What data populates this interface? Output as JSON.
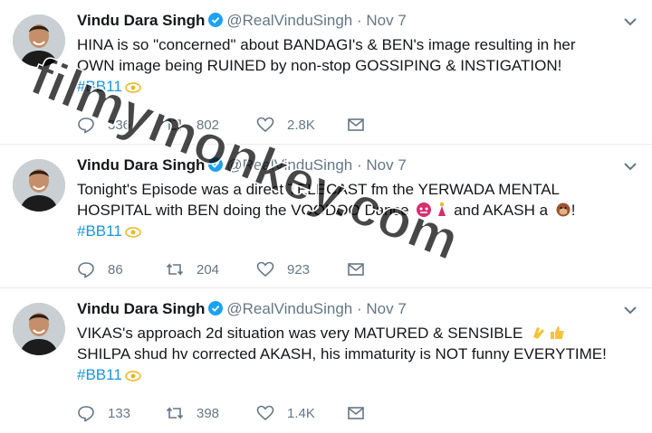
{
  "tweets": [
    {
      "name": "Vindu Dara Singh",
      "handle": "@RealVinduSingh",
      "separator": "·",
      "date": "Nov 7",
      "line1": "HINA is so \"concerned\" about BANDAGI's & BEN's image resulting in her",
      "line2": "OWN image being RUINED by non-stop GOSSIPING & INSTIGATION!",
      "hashtag": "#BB11",
      "replies": "336",
      "retweets": "802",
      "likes": "2.8K"
    },
    {
      "name": "Vindu Dara Singh",
      "handle": "@RealVinduSingh",
      "separator": "·",
      "date": "Nov 7",
      "line1": "Tonight's Episode was a direct TELECAST fm the YERWADA MENTAL",
      "line2a": "HOSPITAL with BEN doing the VOODOO Dance",
      "line2b": "and AKASH a",
      "line2c": "!",
      "hashtag": "#BB11",
      "replies": "86",
      "retweets": "204",
      "likes": "923"
    },
    {
      "name": "Vindu Dara Singh",
      "handle": "@RealVinduSingh",
      "separator": "·",
      "date": "Nov 7",
      "line1": "VIKAS's approach 2d situation was very MATURED & SENSIBLE",
      "line2": "SHILPA shud hv corrected AKASH, his immaturity is NOT funny EVERYTIME!",
      "hashtag": "#BB11",
      "replies": "133",
      "retweets": "398",
      "likes": "1.4K"
    }
  ],
  "watermark": "filmymonkey.com",
  "colors": {
    "text": "#14171a",
    "muted": "#657786",
    "link": "#1b95e0",
    "verified": "#1da1f2",
    "border": "#e6ecf0"
  },
  "icons": {
    "reply": "reply-icon",
    "retweet": "retweet-icon",
    "like": "heart-icon",
    "dm": "envelope-icon",
    "verified": "verified-badge-icon",
    "caret": "chevron-down-icon"
  }
}
